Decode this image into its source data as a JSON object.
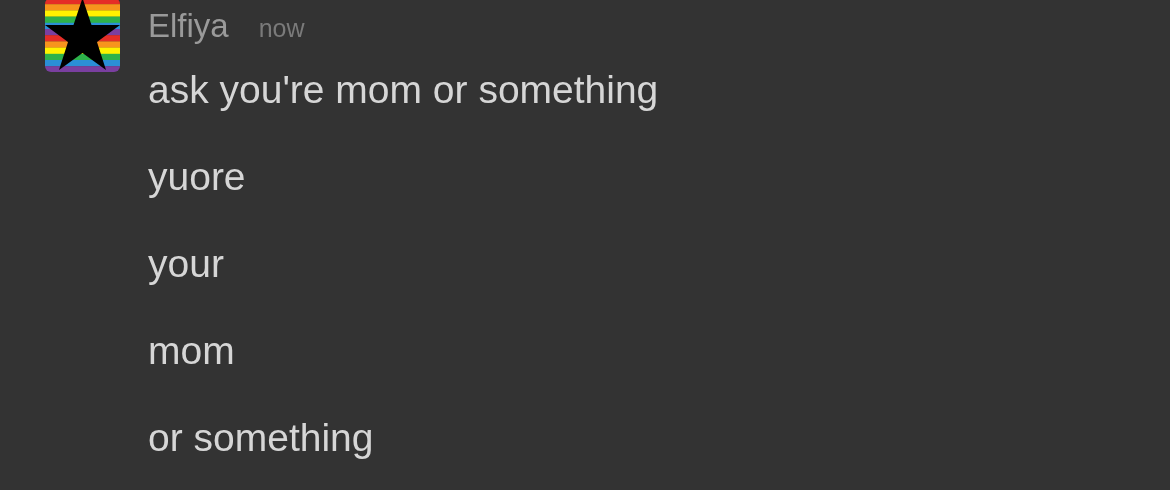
{
  "message": {
    "author": "Elfiya",
    "time": "now",
    "lines": [
      "ask you're mom or something",
      "yuore",
      "your",
      "mom",
      "or something"
    ]
  }
}
